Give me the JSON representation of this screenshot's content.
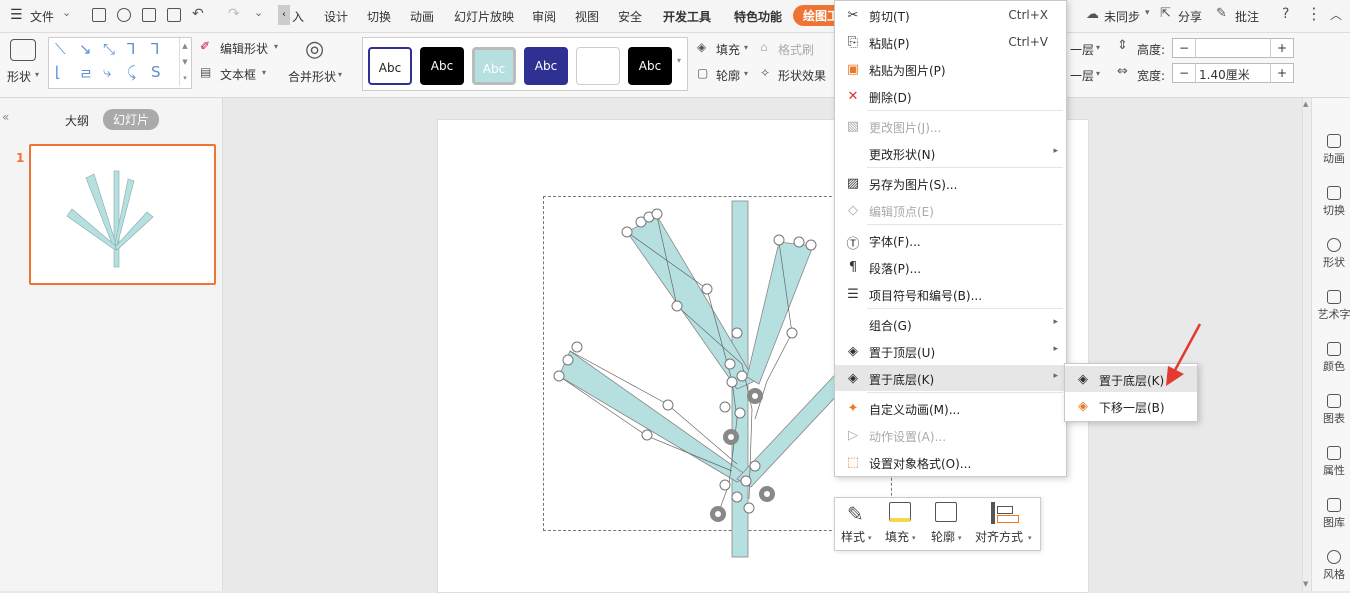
{
  "menubar": {
    "file_label": "文件",
    "tabs": [
      "入",
      "设计",
      "切换",
      "动画",
      "幻灯片放映",
      "审阅",
      "视图",
      "安全",
      "开发工具",
      "特色功能",
      "绘图工"
    ],
    "sync_label": "未同步",
    "share_label": "分享",
    "comment_label": "批注"
  },
  "ribbon": {
    "shape_label": "形状",
    "edit_shape_label": "编辑形状",
    "textbox_label": "文本框",
    "merge_shape_label": "合并形状",
    "style_previews": [
      "Abc",
      "Abc",
      "Abc",
      "Abc",
      "",
      "Abc"
    ],
    "fill_label": "填充",
    "format_brush_label": "格式刷",
    "outline_label": "轮廓",
    "shape_effect_label": "形状效果",
    "layer_up_label": "一层",
    "layer_down_label": "一层",
    "height_label": "高度:",
    "height_value": "",
    "width_label": "宽度:",
    "width_value": "1.40厘米",
    "minus": "−",
    "plus": "+"
  },
  "left_panel": {
    "tab_outline": "大纲",
    "tab_slides": "幻灯片",
    "slide_number": "1"
  },
  "context_menu": {
    "items": [
      {
        "icon": "✂",
        "label": "剪切(T)",
        "shortcut": "Ctrl+X",
        "disabled": false
      },
      {
        "icon": "⎘",
        "label": "粘贴(P)",
        "shortcut": "Ctrl+V",
        "disabled": false
      },
      {
        "icon": "▣",
        "label": "粘贴为图片(P)",
        "shortcut": "",
        "disabled": false
      },
      {
        "icon": "✕",
        "label": "删除(D)",
        "shortcut": "",
        "disabled": false
      },
      {
        "icon": "▧",
        "label": "更改图片(J)...",
        "shortcut": "",
        "disabled": true
      },
      {
        "icon": "",
        "label": "更改形状(N)",
        "shortcut": "",
        "disabled": false,
        "submenu": true
      },
      {
        "icon": "▨",
        "label": "另存为图片(S)...",
        "shortcut": "",
        "disabled": false
      },
      {
        "icon": "◇",
        "label": "编辑顶点(E)",
        "shortcut": "",
        "disabled": true
      },
      {
        "icon": "Ⓣ",
        "label": "字体(F)...",
        "shortcut": "",
        "disabled": false
      },
      {
        "icon": "¶",
        "label": "段落(P)...",
        "shortcut": "",
        "disabled": false
      },
      {
        "icon": "☰",
        "label": "项目符号和编号(B)...",
        "shortcut": "",
        "disabled": false
      },
      {
        "icon": "",
        "label": "组合(G)",
        "shortcut": "",
        "disabled": false,
        "submenu": true
      },
      {
        "icon": "◈",
        "label": "置于顶层(U)",
        "shortcut": "",
        "disabled": false,
        "submenu": true
      },
      {
        "icon": "◈",
        "label": "置于底层(K)",
        "shortcut": "",
        "disabled": false,
        "submenu": true,
        "highlighted": true
      },
      {
        "icon": "✦",
        "label": "自定义动画(M)...",
        "shortcut": "",
        "disabled": false
      },
      {
        "icon": "▷",
        "label": "动作设置(A)...",
        "shortcut": "",
        "disabled": true
      },
      {
        "icon": "⬚",
        "label": "设置对象格式(O)...",
        "shortcut": "",
        "disabled": false
      }
    ],
    "submenu_items": [
      {
        "icon": "◈",
        "label": "置于底层(K)"
      },
      {
        "icon": "◈",
        "label": "下移一层(B)"
      }
    ]
  },
  "mini_toolbar": {
    "style_label": "样式",
    "fill_label": "填充",
    "outline_label": "轮廓",
    "align_label": "对齐方式"
  },
  "right_bar": {
    "items": [
      "动画",
      "切换",
      "形状",
      "艺术字",
      "颜色",
      "图表",
      "属性",
      "图库",
      "风格"
    ]
  },
  "colors": {
    "accent_orange": "#ee7433",
    "shape_fill": "#b6dfe0",
    "red_arrow": "#e23a2e"
  }
}
